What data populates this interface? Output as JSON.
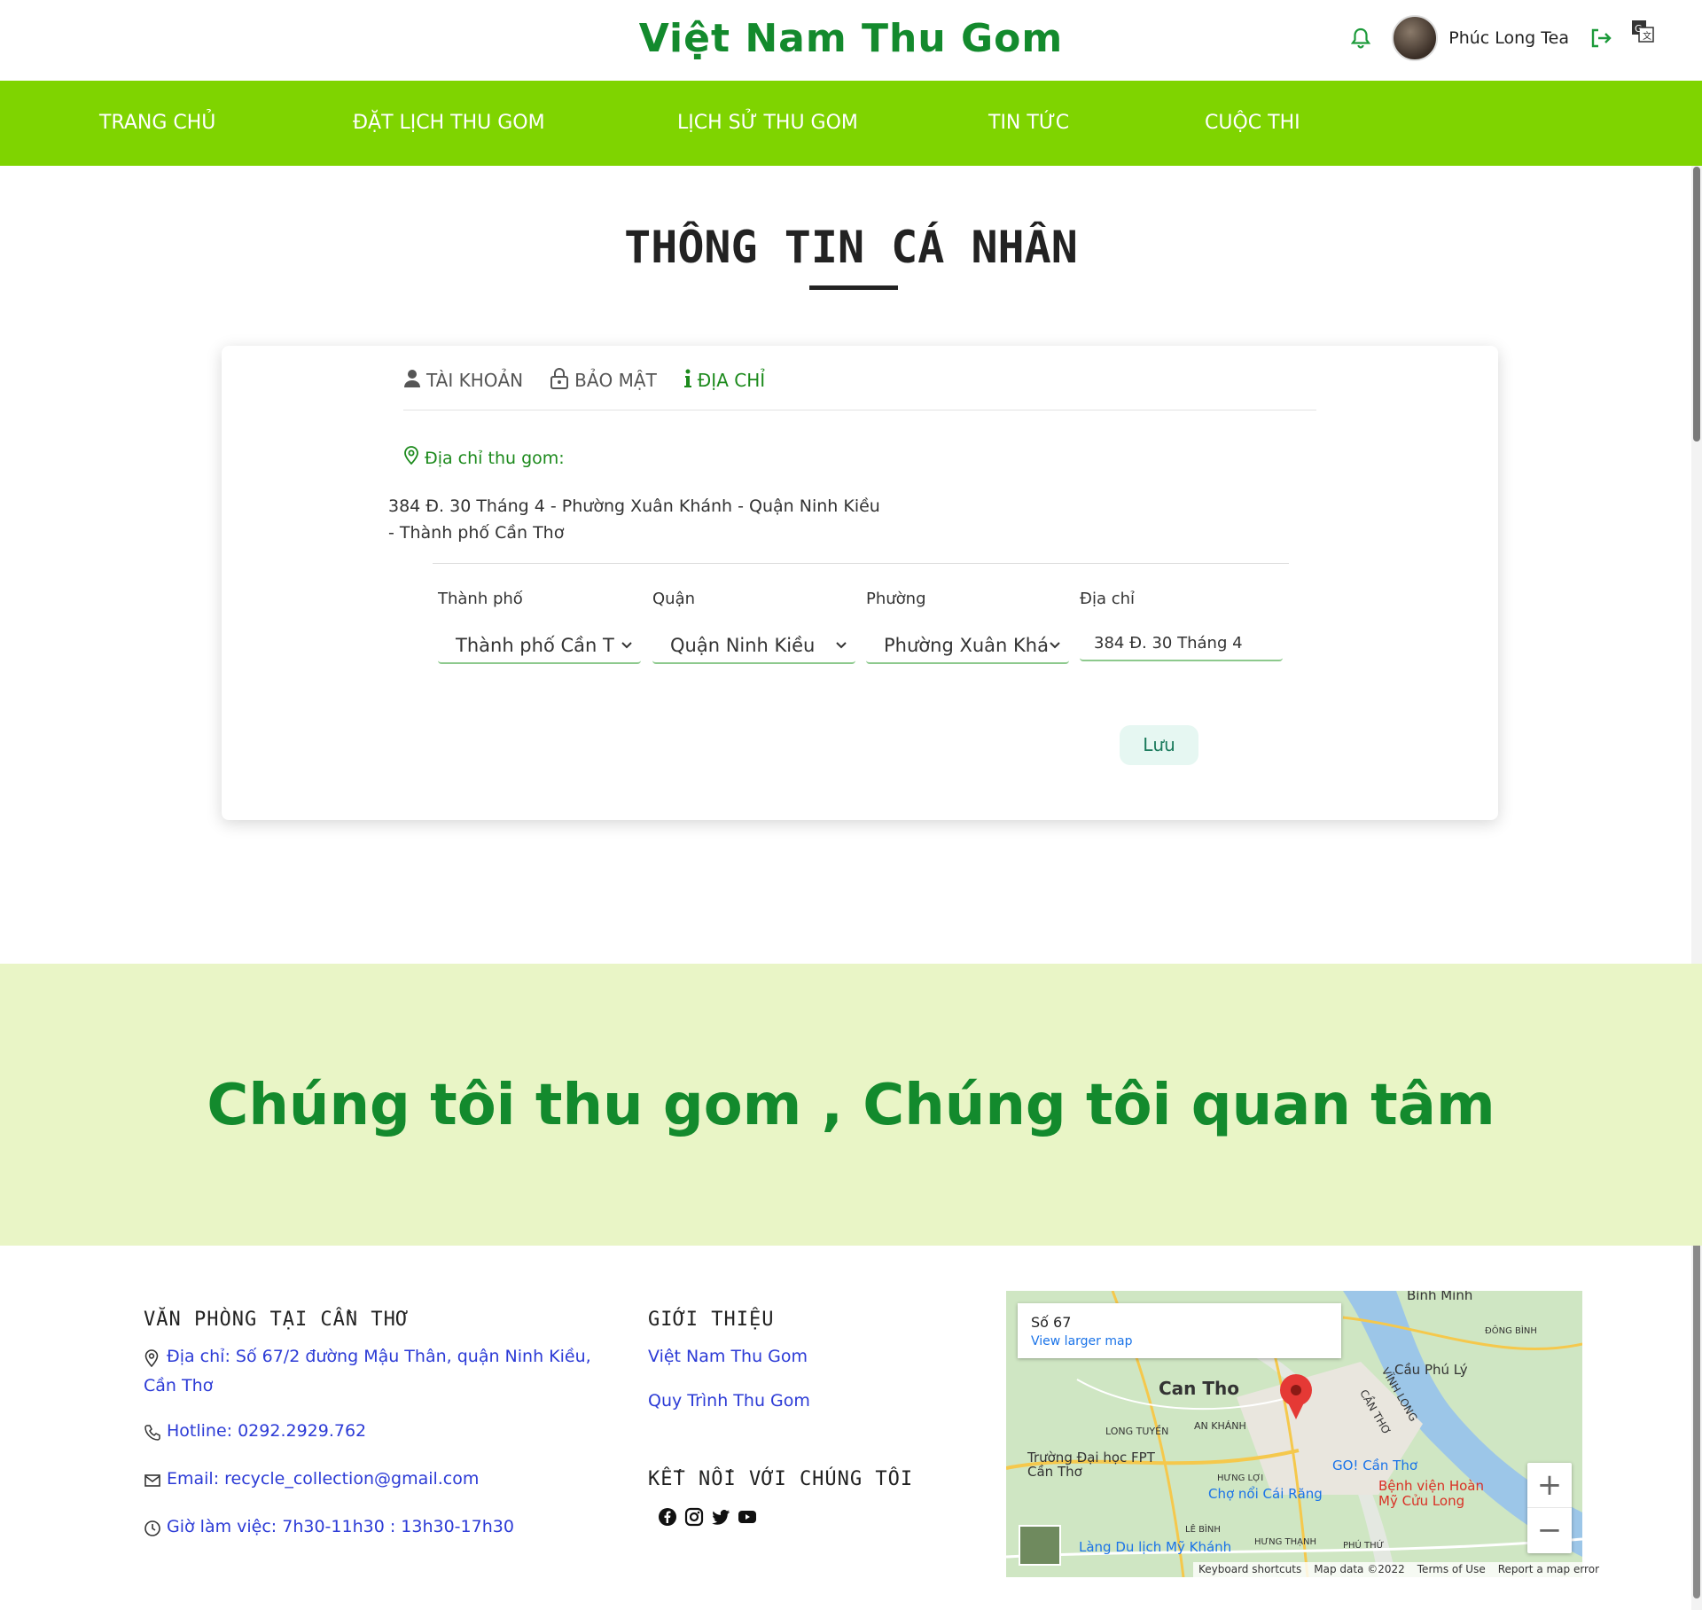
{
  "header": {
    "brand": "Việt Nam Thu Gom",
    "user_name": "Phúc Long Tea"
  },
  "nav": {
    "items": [
      {
        "label": "TRANG CHỦ"
      },
      {
        "label": "ĐẶT LỊCH THU GOM"
      },
      {
        "label": "LỊCH SỬ THU GOM"
      },
      {
        "label": "TIN TỨC"
      },
      {
        "label": "CUỘC THI"
      }
    ]
  },
  "page": {
    "title": "THÔNG TIN CÁ NHÂN"
  },
  "profile": {
    "tabs": [
      {
        "label": "TÀI KHOẢN",
        "icon": "user-icon"
      },
      {
        "label": "BẢO MẬT",
        "icon": "lock-icon"
      },
      {
        "label": "ĐỊA CHỈ",
        "icon": "info-icon",
        "active": true
      }
    ],
    "address_label": "Địa chỉ thu gom:",
    "address_text": "384 Đ. 30 Tháng 4 - Phường Xuân Khánh - Quận Ninh Kiều - Thành phố Cần Thơ",
    "fields": {
      "city": {
        "label": "Thành phố",
        "value": "Thành phố Cần T"
      },
      "district": {
        "label": "Quận",
        "value": "Quận Ninh Kiều"
      },
      "ward": {
        "label": "Phường",
        "value": "Phường Xuân Khá"
      },
      "address": {
        "label": "Địa chỉ",
        "value": "384 Đ. 30 Tháng 4"
      }
    },
    "save_label": "Lưu"
  },
  "slogan": "Chúng tôi thu gom , Chúng tôi quan tâm",
  "footer": {
    "office": {
      "heading": "VĂN PHÒNG TẠI CẦN THƠ",
      "address": "Địa chỉ: Số 67/2 đường Mậu Thân, quận Ninh Kiều, Cần Thơ",
      "hotline": "Hotline: 0292.2929.762",
      "email": "Email: recycle_collection@gmail.com",
      "hours": "Giờ làm việc: 7h30-11h30 : 13h30-17h30"
    },
    "about": {
      "heading": "GIỚI THIỆU",
      "links": [
        "Việt Nam Thu Gom",
        "Quy Trình Thu Gom"
      ]
    },
    "connect": {
      "heading": "KẾT NỐI VỚI CHÚNG TÔI",
      "icons": [
        "facebook-icon",
        "instagram-icon",
        "twitter-icon",
        "youtube-icon"
      ]
    },
    "map": {
      "place": "Số 67",
      "view_larger": "View larger map",
      "labels": [
        "Can Tho",
        "Bình Minh",
        "Cầu Phú Lý",
        "LONG TUYỀN",
        "AN KHÁNH",
        "Trường Đại học FPT Cần Thơ",
        "GO! Cần Thơ",
        "Chợ nổi Cái Răng",
        "Bệnh viện Hoàn Mỹ Cửu Long",
        "Làng Du lịch Mỹ Khánh",
        "VĨNH LONG",
        "CẦN THƠ",
        "HƯNG LỢI",
        "LÊ BÌNH",
        "HƯNG THẠNH",
        "PHÚ THỨ",
        "ĐÔNG BÌNH"
      ],
      "attrib": [
        "Keyboard shortcuts",
        "Map data ©2022",
        "Terms of Use",
        "Report a map error"
      ]
    }
  },
  "colors": {
    "brand_green": "#138a2d",
    "nav_green": "#7fd400",
    "band_bg": "#e9f5c6",
    "link_blue": "#2c3bd6"
  }
}
